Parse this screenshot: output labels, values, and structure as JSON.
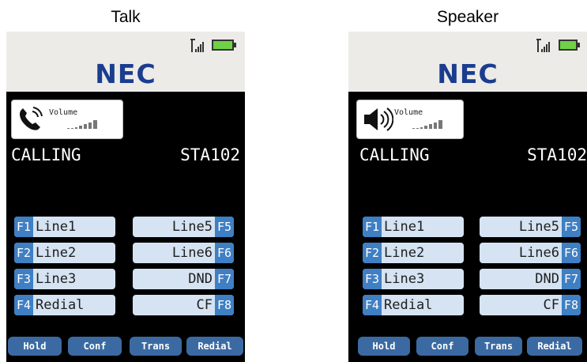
{
  "panels": [
    {
      "title": "Talk",
      "brand": "NEC",
      "mode_icon": "handset-icon",
      "volume_label": "Volume",
      "status": "CALLING",
      "station": "STA102",
      "fkeys_left": [
        {
          "tag": "F1",
          "label": "Line1"
        },
        {
          "tag": "F2",
          "label": "Line2"
        },
        {
          "tag": "F3",
          "label": "Line3"
        },
        {
          "tag": "F4",
          "label": "Redial"
        }
      ],
      "fkeys_right": [
        {
          "tag": "F5",
          "label": "Line5"
        },
        {
          "tag": "F6",
          "label": "Line6"
        },
        {
          "tag": "F7",
          "label": "DND"
        },
        {
          "tag": "F8",
          "label": "CF"
        }
      ],
      "softkeys": [
        "Hold",
        "Conf",
        "Trans",
        "Redial"
      ]
    },
    {
      "title": "Speaker",
      "brand": "NEC",
      "mode_icon": "speaker-icon",
      "volume_label": "Volume",
      "status": "CALLING",
      "station": "STA102",
      "fkeys_left": [
        {
          "tag": "F1",
          "label": "Line1"
        },
        {
          "tag": "F2",
          "label": "Line2"
        },
        {
          "tag": "F3",
          "label": "Line3"
        },
        {
          "tag": "F4",
          "label": "Redial"
        }
      ],
      "fkeys_right": [
        {
          "tag": "F5",
          "label": "Line5"
        },
        {
          "tag": "F6",
          "label": "Line6"
        },
        {
          "tag": "F7",
          "label": "DND"
        },
        {
          "tag": "F8",
          "label": "CF"
        }
      ],
      "softkeys": [
        "Hold",
        "Conf",
        "Trans",
        "Redial"
      ]
    }
  ],
  "colors": {
    "brand": "#1b3d8f",
    "header_bg": "#ecebe8",
    "screen_bg": "#000000",
    "fkey_bg": "#d5e3f2",
    "fkey_tag": "#3f7fc3",
    "softkey_bg": "#3b6aa3",
    "battery": "#6fd246"
  }
}
